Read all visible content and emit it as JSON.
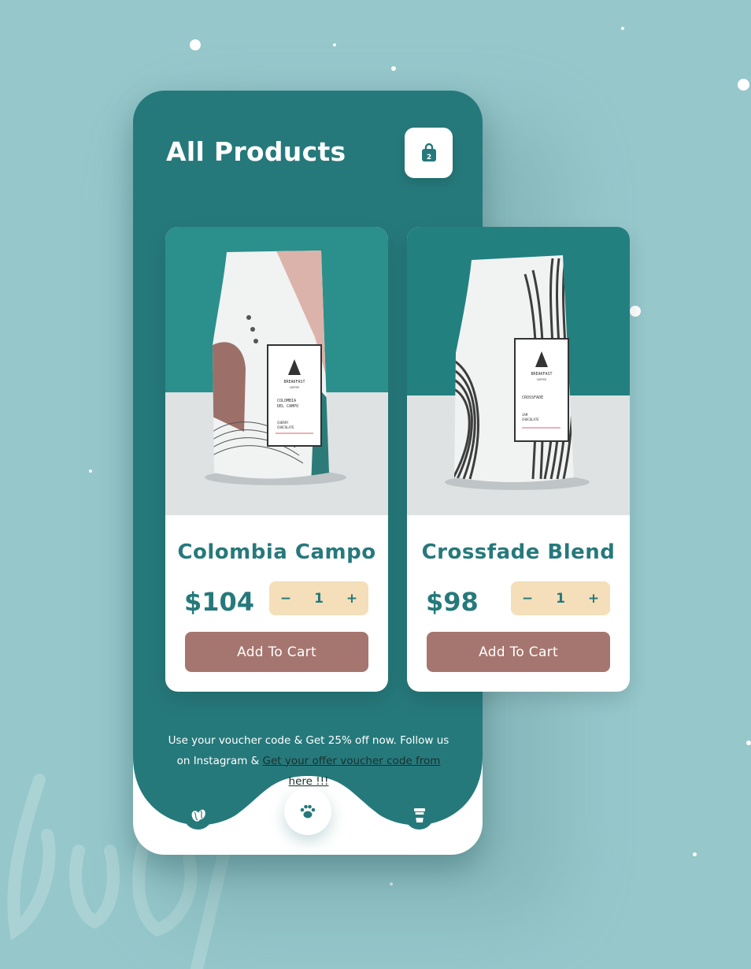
{
  "header": {
    "title": "All Products",
    "cart_count": "2"
  },
  "products": [
    {
      "name": "Colombia Campo",
      "price": "$104",
      "quantity": "1",
      "decrement": "−",
      "increment": "+",
      "add_label": "Add To Cart",
      "bag": {
        "brand": "BREAKFAST",
        "sub": "COFFEE",
        "line1": "COLOMBIA",
        "line2": "DEL CAMPO",
        "notes1": "CHERRY",
        "notes2": "CHOCOLATE"
      }
    },
    {
      "name": "Crossfade Blend",
      "price": "$98",
      "quantity": "1",
      "decrement": "−",
      "increment": "+",
      "add_label": "Add To Cart",
      "bag": {
        "brand": "BREAKFAST",
        "sub": "COFFEE",
        "line1": "CROSSFADE",
        "line2": "",
        "notes1": "JAM",
        "notes2": "CHOCOLATE"
      }
    }
  ],
  "promo": {
    "text": "Use your voucher code & Get 25% off now. Follow us on Instagram & ",
    "link": "Get your offer voucher code from here !!!"
  },
  "nav": {
    "items": [
      {
        "icon": "coffee-bean-icon"
      },
      {
        "icon": "paw-icon",
        "active": true
      },
      {
        "icon": "coffee-cup-icon"
      }
    ]
  },
  "colors": {
    "teal": "#26797b",
    "background": "#95c7cb",
    "button": "#a5766f",
    "stepper": "#f4dfba",
    "white": "#ffffff"
  }
}
